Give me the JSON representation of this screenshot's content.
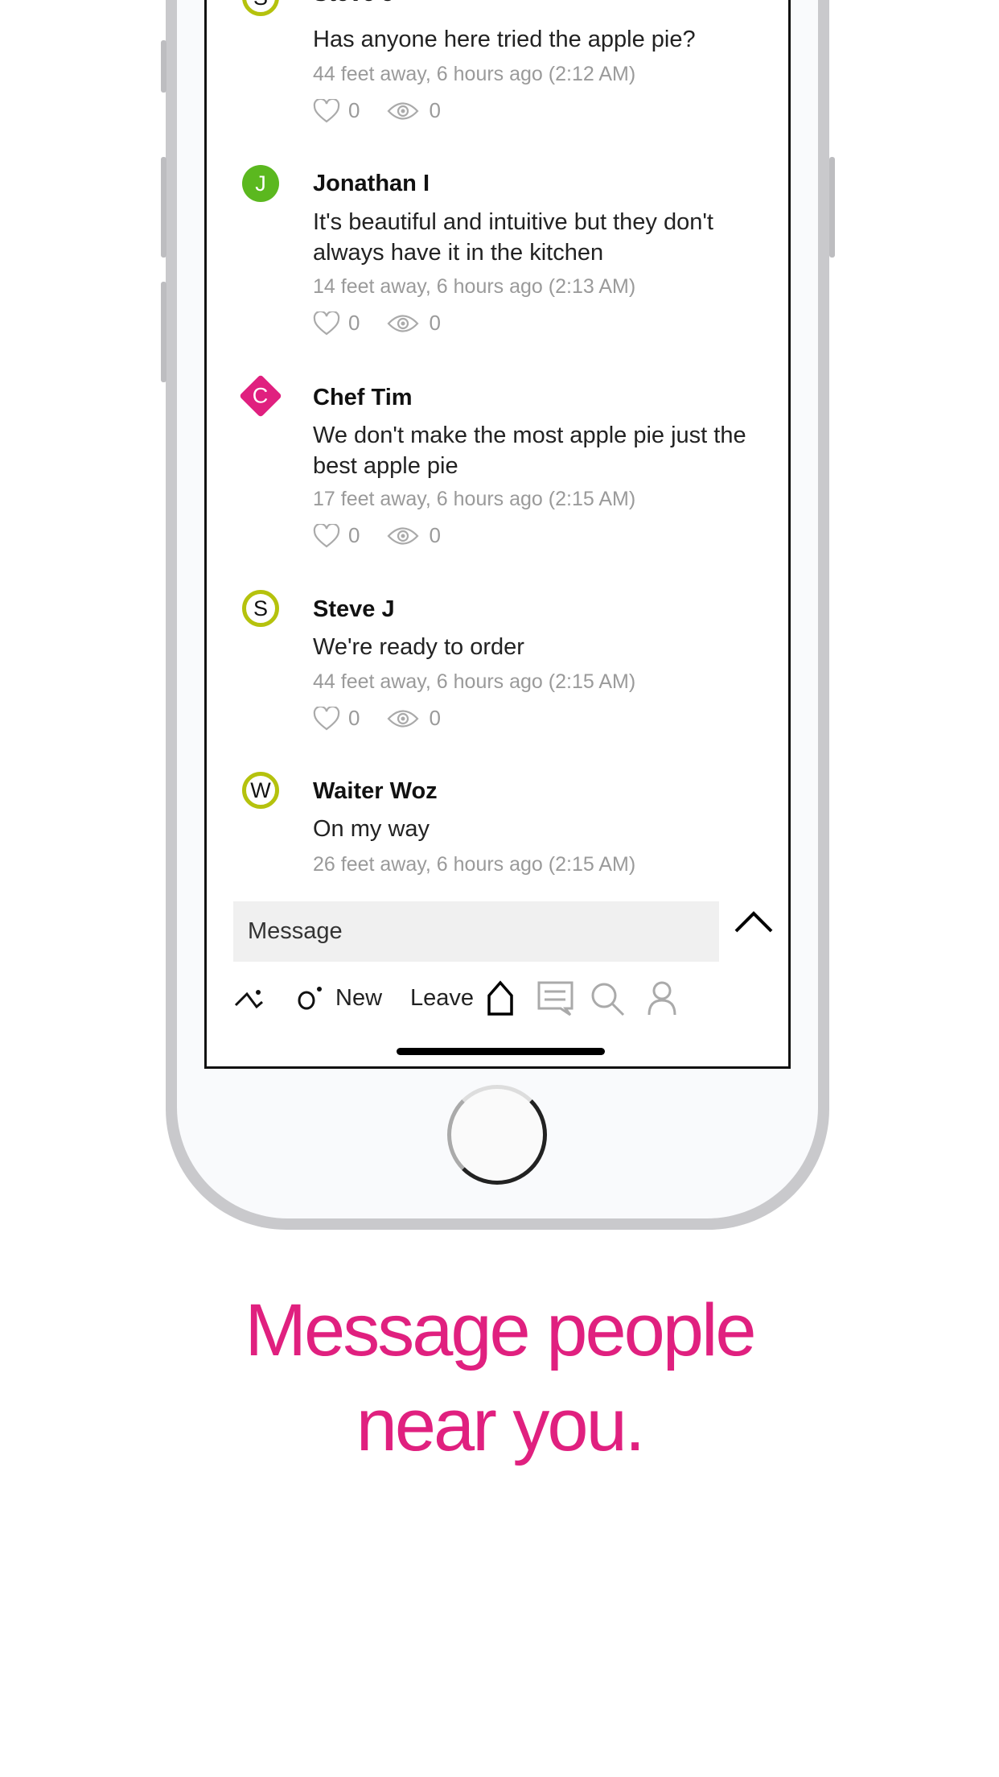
{
  "messages": [
    {
      "name": "Steve J",
      "initial": "S",
      "avatar_style": "ring",
      "text": "Has anyone here tried the apple pie?",
      "meta": "44 feet away, 6 hours ago (2:12 AM)",
      "likes": "0",
      "views": "0"
    },
    {
      "name": "Jonathan I",
      "initial": "J",
      "avatar_style": "solid",
      "avatar_color": "#5bb81f",
      "text": "It's beautiful and intuitive but they don't always have it in the kitchen",
      "meta": "14 feet away, 6 hours ago (2:13 AM)",
      "likes": "0",
      "views": "0"
    },
    {
      "name": "Chef Tim",
      "initial": "C",
      "avatar_style": "diamond",
      "avatar_color": "#e0207f",
      "text": "We don't make the most apple pie just the best apple pie",
      "meta": "17 feet away, 6 hours ago (2:15 AM)",
      "likes": "0",
      "views": "0"
    },
    {
      "name": "Steve J",
      "initial": "S",
      "avatar_style": "ring",
      "text": "We're ready to order",
      "meta": "44 feet away, 6 hours ago (2:15 AM)",
      "likes": "0",
      "views": "0"
    },
    {
      "name": "Waiter Woz",
      "initial": "W",
      "avatar_style": "ring",
      "text": "On my way",
      "meta": "26 feet away, 6 hours ago (2:15 AM)"
    }
  ],
  "composer": {
    "placeholder": "Message"
  },
  "toolbar": {
    "new_label": "New",
    "leave_label": "Leave"
  },
  "tabs": [
    "home-icon",
    "chat-icon",
    "search-icon",
    "profile-icon"
  ],
  "caption": {
    "line1": "Message people",
    "line2": "near you."
  },
  "colors": {
    "accent": "#e0207f",
    "ring": "#b5c20d"
  }
}
